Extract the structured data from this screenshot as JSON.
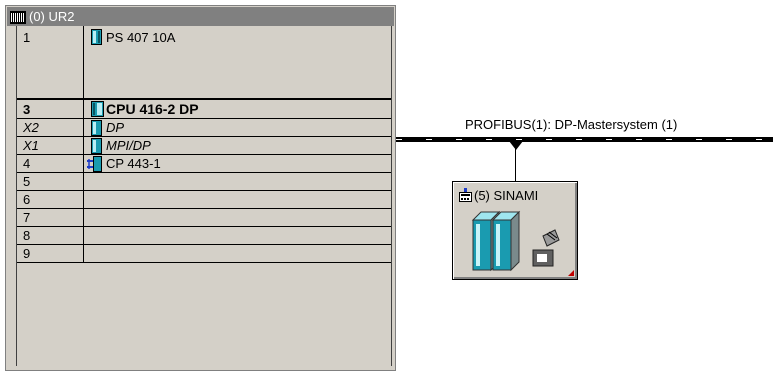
{
  "rack": {
    "title": "(0) UR2",
    "rows": [
      {
        "slot": "1",
        "module": "PS 407 10A",
        "style": "normal"
      },
      {
        "slot": "3",
        "module": "CPU 416-2 DP",
        "style": "bold"
      },
      {
        "slot": "X2",
        "module": "DP",
        "style": "italic"
      },
      {
        "slot": "X1",
        "module": "MPI/DP",
        "style": "italic"
      },
      {
        "slot": "4",
        "module": "CP 443-1",
        "style": "normal"
      },
      {
        "slot": "5",
        "module": "",
        "style": "normal"
      },
      {
        "slot": "6",
        "module": "",
        "style": "normal"
      },
      {
        "slot": "7",
        "module": "",
        "style": "normal"
      },
      {
        "slot": "8",
        "module": "",
        "style": "normal"
      },
      {
        "slot": "9",
        "module": "",
        "style": "normal"
      }
    ]
  },
  "profibus": {
    "label": "PROFIBUS(1): DP-Mastersystem (1)"
  },
  "device": {
    "title": "(5) SINAMI",
    "icon": "drive-module-icon"
  },
  "colors": {
    "window_bg": "#d4d0c8",
    "title_bg": "#808080",
    "module_teal": "#1a9bb0"
  }
}
